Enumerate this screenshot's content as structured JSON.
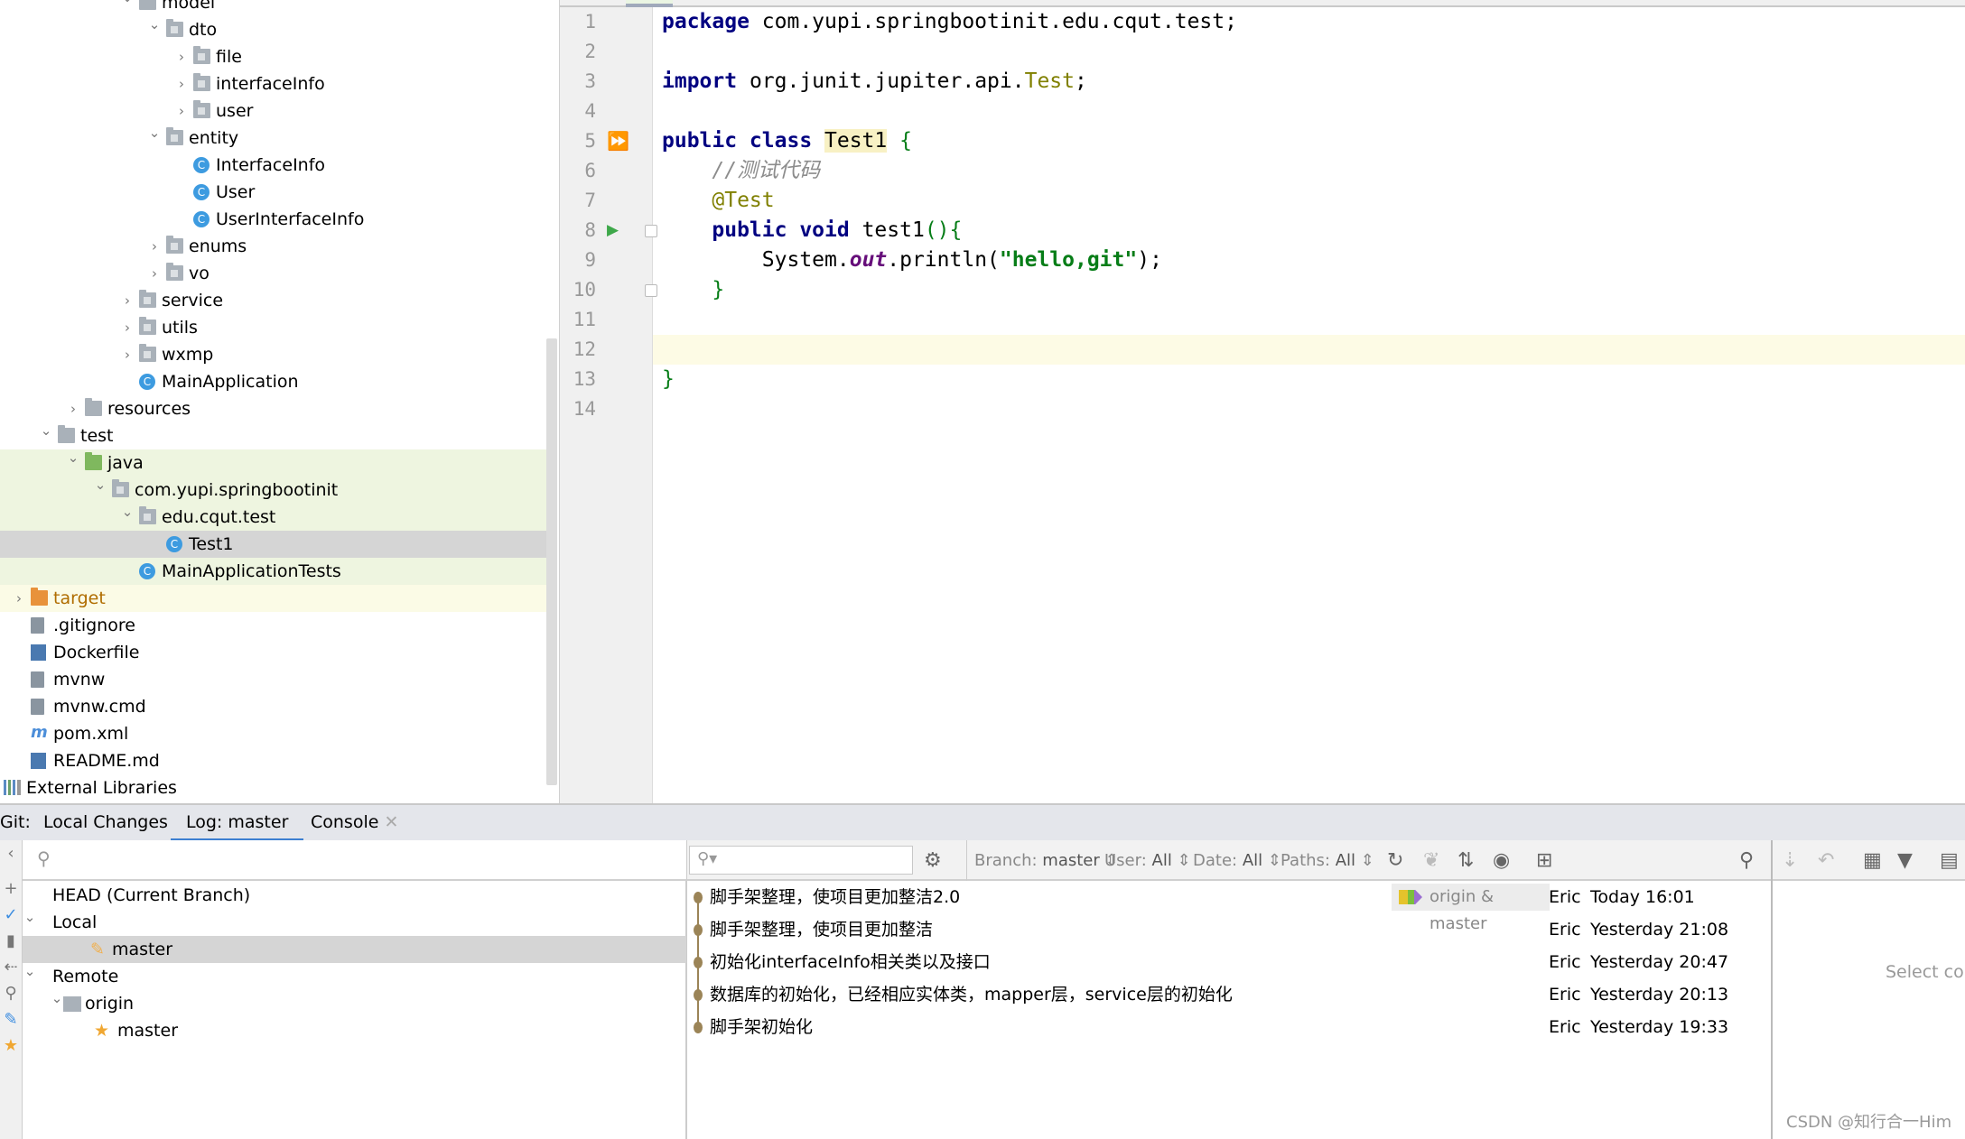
{
  "project_tree": {
    "items": [
      {
        "label": "model",
        "level": 4,
        "expanded": true,
        "icon": "folder"
      },
      {
        "label": "dto",
        "level": 5,
        "expanded": true,
        "icon": "package-folder"
      },
      {
        "label": "file",
        "level": 6,
        "expanded": false,
        "icon": "package-folder"
      },
      {
        "label": "interfaceInfo",
        "level": 6,
        "expanded": false,
        "icon": "package-folder"
      },
      {
        "label": "user",
        "level": 6,
        "expanded": false,
        "icon": "package-folder"
      },
      {
        "label": "entity",
        "level": 5,
        "expanded": true,
        "icon": "package-folder"
      },
      {
        "label": "InterfaceInfo",
        "level": 6,
        "icon": "java-class"
      },
      {
        "label": "User",
        "level": 6,
        "icon": "java-class"
      },
      {
        "label": "UserInterfaceInfo",
        "level": 6,
        "icon": "java-class"
      },
      {
        "label": "enums",
        "level": 5,
        "expanded": false,
        "icon": "package-folder"
      },
      {
        "label": "vo",
        "level": 5,
        "expanded": false,
        "icon": "package-folder"
      },
      {
        "label": "service",
        "level": 4,
        "expanded": false,
        "icon": "package-folder"
      },
      {
        "label": "utils",
        "level": 4,
        "expanded": false,
        "icon": "package-folder"
      },
      {
        "label": "wxmp",
        "level": 4,
        "expanded": false,
        "icon": "package-folder"
      },
      {
        "label": "MainApplication",
        "level": 4,
        "icon": "java-class"
      },
      {
        "label": "resources",
        "level": 2,
        "expanded": false,
        "icon": "resources-folder"
      },
      {
        "label": "test",
        "level": 1,
        "expanded": true,
        "icon": "folder"
      },
      {
        "label": "java",
        "level": 2,
        "expanded": true,
        "icon": "test-source-folder",
        "highlight": "green"
      },
      {
        "label": "com.yupi.springbootinit",
        "level": 3,
        "expanded": true,
        "icon": "package-folder",
        "highlight": "green"
      },
      {
        "label": "edu.cqut.test",
        "level": 4,
        "expanded": true,
        "icon": "package-folder",
        "highlight": "green"
      },
      {
        "label": "Test1",
        "level": 5,
        "icon": "java-class",
        "highlight": "selected"
      },
      {
        "label": "MainApplicationTests",
        "level": 4,
        "icon": "java-class",
        "highlight": "green"
      },
      {
        "label": "target",
        "level": 0,
        "expanded": false,
        "icon": "excluded-folder",
        "highlight": "yellow"
      },
      {
        "label": ".gitignore",
        "level": 0,
        "icon": "file"
      },
      {
        "label": "Dockerfile",
        "level": 0,
        "icon": "docker-file"
      },
      {
        "label": "mvnw",
        "level": 0,
        "icon": "file"
      },
      {
        "label": "mvnw.cmd",
        "level": 0,
        "icon": "file"
      },
      {
        "label": "pom.xml",
        "level": 0,
        "icon": "maven"
      },
      {
        "label": "README.md",
        "level": 0,
        "icon": "markdown"
      },
      {
        "label": "External Libraries",
        "level": -1,
        "icon": "libraries"
      }
    ]
  },
  "editor": {
    "current_line": 12,
    "lines": [
      [
        [
          "package",
          "keyword"
        ],
        [
          " com.yupi.springbootinit.edu.cqut.test;",
          "plain"
        ]
      ],
      [],
      [
        [
          "import",
          "keyword"
        ],
        [
          " org.junit.jupiter.api.",
          "plain"
        ],
        [
          "Test",
          "classref"
        ],
        [
          ";",
          "plain"
        ]
      ],
      [],
      [
        [
          "public class ",
          "keyword"
        ],
        [
          "Test1",
          "classdecl"
        ],
        [
          " ",
          "plain"
        ],
        [
          "{",
          "brace"
        ]
      ],
      [
        [
          "    ",
          "plain"
        ],
        [
          "//测试代码",
          "comment"
        ]
      ],
      [
        [
          "    ",
          "plain"
        ],
        [
          "@Test",
          "annotation"
        ]
      ],
      [
        [
          "    ",
          "plain"
        ],
        [
          "public void ",
          "keyword"
        ],
        [
          "test1",
          "plain"
        ],
        [
          "(){",
          "brace"
        ]
      ],
      [
        [
          "        System.",
          "plain"
        ],
        [
          "out",
          "italicfield"
        ],
        [
          ".println(",
          "plain"
        ],
        [
          "\"hello,git\"",
          "string"
        ],
        [
          ");",
          "plain"
        ]
      ],
      [
        [
          "    ",
          "plain"
        ],
        [
          "}",
          "brace"
        ]
      ],
      [],
      [],
      [
        [
          "}",
          "brace"
        ]
      ],
      []
    ],
    "gutter_icons": [
      {
        "line": 5,
        "icon": "run-all-icon"
      },
      {
        "line": 8,
        "icon": "run-icon"
      }
    ]
  },
  "git_panel": {
    "prefix": "Git:",
    "tabs": [
      {
        "label": "Local Changes"
      },
      {
        "label": "Log: master",
        "active": true
      },
      {
        "label": "Console",
        "closable": true
      }
    ],
    "branches": [
      {
        "label": "HEAD (Current Branch)",
        "level": 0
      },
      {
        "label": "Local",
        "level": 0,
        "expanded": true
      },
      {
        "label": "master",
        "level": 2,
        "icon": "tag-icon",
        "selected": true
      },
      {
        "label": "Remote",
        "level": 0,
        "expanded": true
      },
      {
        "label": "origin",
        "level": 1,
        "expanded": true,
        "icon": "folder-icon"
      },
      {
        "label": "master",
        "level": 2,
        "icon": "star-icon"
      }
    ],
    "filters": {
      "branch_label": "Branch:",
      "branch_value": "master",
      "user_label": "User:",
      "user_value": "All",
      "date_label": "Date:",
      "date_value": "All",
      "paths_label": "Paths:",
      "paths_value": "All"
    },
    "commits": [
      {
        "message": "脚手架整理，使项目更加整洁2.0",
        "refs": "origin & master",
        "author": "Eric",
        "date": "Today 16:01"
      },
      {
        "message": "脚手架整理，使项目更加整洁",
        "author": "Eric",
        "date": "Yesterday 21:08"
      },
      {
        "message": "初始化interfaceInfo相关类以及接口",
        "author": "Eric",
        "date": "Yesterday 20:47"
      },
      {
        "message": "数据库的初始化，已经相应实体类，mapper层，service层的初始化",
        "author": "Eric",
        "date": "Yesterday 20:13"
      },
      {
        "message": "脚手架初始化",
        "author": "Eric",
        "date": "Yesterday 19:33"
      }
    ],
    "details_placeholder": "Select com",
    "graph_color": "#9b8457",
    "accent": "#3d7fd1"
  },
  "watermark": "CSDN @知行合一Him"
}
